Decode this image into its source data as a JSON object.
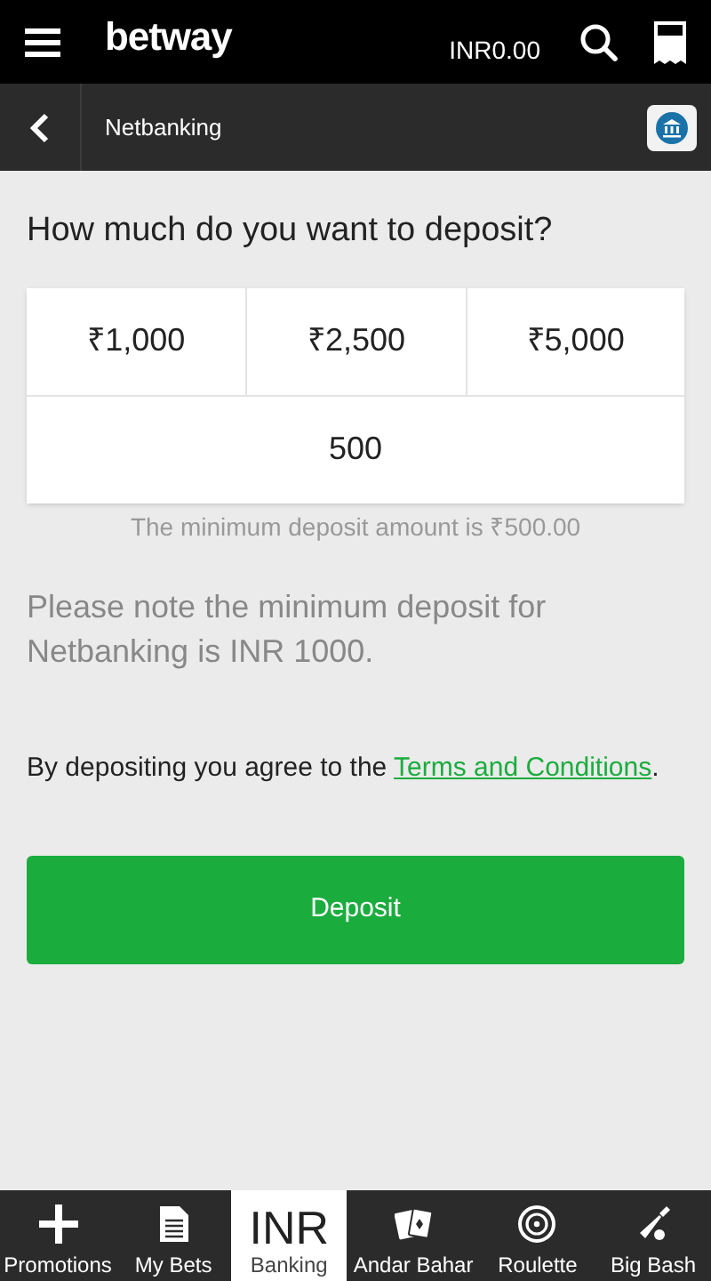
{
  "header": {
    "logo": "betway",
    "balance": "INR0.00"
  },
  "subheader": {
    "title": "Netbanking"
  },
  "heading": "How much do you want to deposit?",
  "quick_amounts": [
    {
      "label": "₹1,000"
    },
    {
      "label": "₹2,500"
    },
    {
      "label": "₹5,000"
    }
  ],
  "amount_field": {
    "value": "500"
  },
  "minimum_hint": "The minimum deposit amount is ₹500.00",
  "note": "Please note the minimum deposit for Netbanking is INR 1000.",
  "agreement": {
    "text": "By depositing you agree to the ",
    "link": "Terms and Conditions",
    "end": "."
  },
  "deposit_button": "Deposit",
  "bottom_nav": [
    {
      "label": "Promotions",
      "kind": "plus",
      "selected": false
    },
    {
      "label": "My Bets",
      "kind": "document",
      "selected": false
    },
    {
      "label": "Banking",
      "kind": "text",
      "icon_text": "INR",
      "selected": true
    },
    {
      "label": "Andar Bahar",
      "kind": "cards",
      "selected": false
    },
    {
      "label": "Roulette",
      "kind": "roulette",
      "selected": false
    },
    {
      "label": "Big Bash",
      "kind": "bat",
      "selected": false
    }
  ]
}
